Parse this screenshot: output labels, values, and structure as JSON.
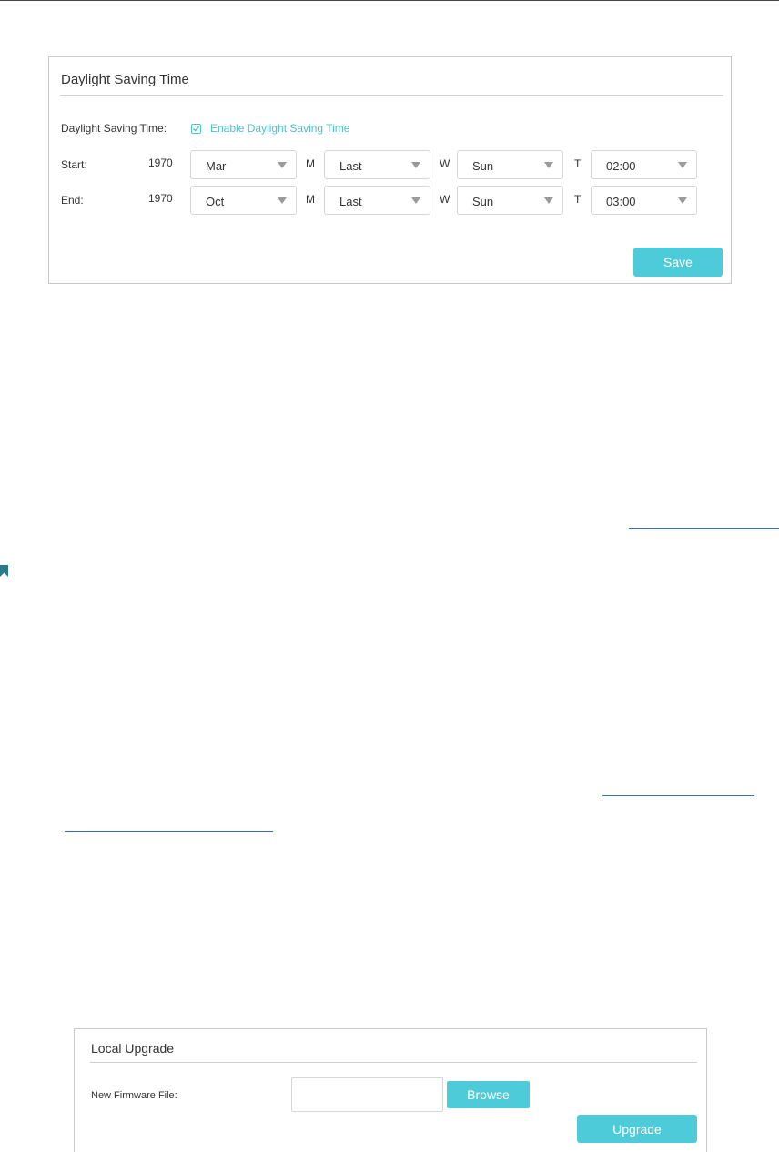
{
  "dst_panel": {
    "title": "Daylight Saving Time",
    "dst_label": "Daylight Saving Time:",
    "enable_label": "Enable Daylight Saving Time",
    "enable_checked": true,
    "start": {
      "label": "Start:",
      "year": "1970",
      "month": "Mar",
      "m_letter": "M",
      "week": "Last",
      "w_letter": "W",
      "day": "Sun",
      "t_letter": "T",
      "time": "02:00"
    },
    "end": {
      "label": "End:",
      "year": "1970",
      "month": "Oct",
      "m_letter": "M",
      "week": "Last",
      "w_letter": "W",
      "day": "Sun",
      "t_letter": "T",
      "time": "03:00"
    },
    "save_label": "Save"
  },
  "upgrade_panel": {
    "title": "Local Upgrade",
    "file_label": "New Firmware File:",
    "file_value": "",
    "browse_label": "Browse",
    "upgrade_label": "Upgrade"
  },
  "colors": {
    "accent": "#4ecbd8",
    "link": "#3b6fb3",
    "bookmark": "#2b7a8c"
  }
}
